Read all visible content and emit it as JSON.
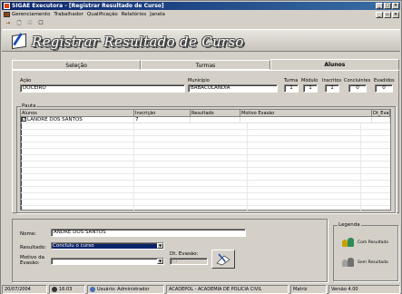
{
  "window": {
    "title": "SIGAE Executora - [Registrar Resultado de Curso]"
  },
  "menu": [
    "Gerenciamento",
    "Trabalhador",
    "Qualificação",
    "Relatórios",
    "Janela"
  ],
  "banner": {
    "title": "Registrar Resultado de Curso"
  },
  "tabs": [
    "Seleção",
    "Turmas",
    "Alunos"
  ],
  "form": {
    "acao_label": "Ação",
    "acao_value": "DOCEIRO",
    "municipio_label": "Município",
    "municipio_value": "BABACULANDIA",
    "turma_label": "Turma",
    "turma_value": "1",
    "modulo_label": "Módulo",
    "modulo_value": "1",
    "inscritos_label": "Inscritos",
    "inscritos_value": "1",
    "concluintes_label": "Concluintes",
    "concluintes_value": "0",
    "evadidos_label": "Evadidos",
    "evadidos_value": "0"
  },
  "pauta": {
    "title": "Pauta",
    "columns": [
      "Alunos",
      "Inscrição",
      "Resultado",
      "Motivo Evasão",
      "Dt_Evasao"
    ],
    "rows": [
      {
        "aluno": "LANDRE DOS SANTOS",
        "inscricao": "7",
        "resultado": "",
        "motivo": "",
        "dt": ""
      }
    ]
  },
  "detail": {
    "nome_label": "Nome:",
    "nome_value": "ANDRE DOS SANTOS",
    "resultado_label": "Resultado:",
    "resultado_value": "Concluiu o curso",
    "motivo_label": "Motivo da Evasão:",
    "motivo_value": "",
    "dt_label": "Dt. Evasão:",
    "dt_value": "/ /"
  },
  "legend": {
    "title": "Legenda",
    "com": "Com Resultado",
    "sem": "Sem Resultado"
  },
  "status": {
    "date": "20/07/2004",
    "time": "16:03",
    "user": "Usuário: Administrador",
    "org": "ACADEPOL - ACADEMIA DE POLICIA CIVIL",
    "unit": "Matriz",
    "version": "Versão 4.00"
  },
  "colors": {
    "title_bar": "#0a246a",
    "selection": "#0a246a",
    "legend_green": "#2e8b57",
    "legend_gray": "#808080"
  }
}
